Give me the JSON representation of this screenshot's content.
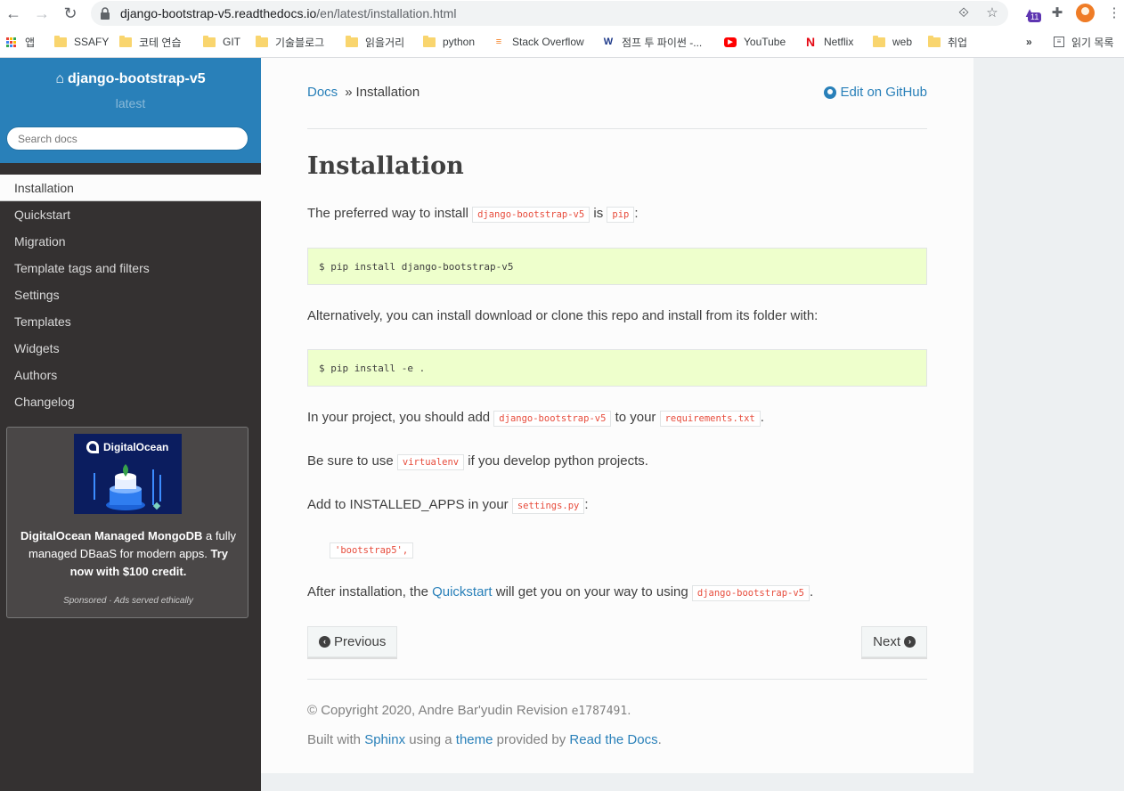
{
  "browser": {
    "url_host": "django-bootstrap-v5.readthedocs.io",
    "url_path": "/en/latest/installation.html",
    "extension_badge": "11",
    "bookmarks": [
      {
        "label": "앱",
        "icon": "apps-grid-icon"
      },
      {
        "label": "SSAFY",
        "icon": "folder-icon"
      },
      {
        "label": "코테 연습",
        "icon": "folder-icon"
      },
      {
        "label": "GIT",
        "icon": "folder-icon"
      },
      {
        "label": "기술블로그",
        "icon": "folder-icon"
      },
      {
        "label": "읽을거리",
        "icon": "folder-icon"
      },
      {
        "label": "python",
        "icon": "folder-icon"
      },
      {
        "label": "Stack Overflow",
        "icon": "stackoverflow-icon"
      },
      {
        "label": "점프 투 파이썬 -...",
        "icon": "wikidocs-icon"
      },
      {
        "label": "YouTube",
        "icon": "youtube-icon"
      },
      {
        "label": "Netflix",
        "icon": "netflix-icon"
      },
      {
        "label": "web",
        "icon": "folder-icon"
      },
      {
        "label": "취업",
        "icon": "folder-icon"
      }
    ],
    "more_bookmarks": "»",
    "reading_list": "읽기 목록"
  },
  "sidebar": {
    "project": "django-bootstrap-v5",
    "version": "latest",
    "search_placeholder": "Search docs",
    "items": [
      {
        "label": "Installation"
      },
      {
        "label": "Quickstart"
      },
      {
        "label": "Migration"
      },
      {
        "label": "Template tags and filters"
      },
      {
        "label": "Settings"
      },
      {
        "label": "Templates"
      },
      {
        "label": "Widgets"
      },
      {
        "label": "Authors"
      },
      {
        "label": "Changelog"
      }
    ],
    "ad": {
      "brand": "DigitalOcean",
      "headline": "DigitalOcean Managed MongoDB",
      "body": " a fully managed DBaaS for modern apps. ",
      "cta": "Try now with $100 credit.",
      "sponsor": "Sponsored · Ads served ethically"
    }
  },
  "content": {
    "breadcrumb_root": "Docs",
    "breadcrumb_sep": "»",
    "breadcrumb_current": "Installation",
    "edit_link": "Edit on GitHub",
    "title": "Installation",
    "p1_a": "The preferred way to install ",
    "p1_code1": "django-bootstrap-v5",
    "p1_b": " is ",
    "p1_code2": "pip",
    "p1_c": ":",
    "code1": "$ pip install django-bootstrap-v5",
    "p2": "Alternatively, you can install download or clone this repo and install from its folder with:",
    "code2": "$ pip install -e .",
    "p3_a": "In your project, you should add ",
    "p3_code1": "django-bootstrap-v5",
    "p3_b": " to your ",
    "p3_code2": "requirements.txt",
    "p3_c": ".",
    "p4_a": "Be sure to use ",
    "p4_code": "virtualenv",
    "p4_b": " if you develop python projects.",
    "p5_a": "Add to INSTALLED_APPS in your ",
    "p5_code": "settings.py",
    "p5_b": ":",
    "snippet": "'bootstrap5',",
    "p6_a": "After installation, the ",
    "p6_link": "Quickstart",
    "p6_b": " will get you on your way to using ",
    "p6_code": "django-bootstrap-v5",
    "p6_c": ".",
    "prev": "Previous",
    "next": "Next",
    "copyright": "© Copyright 2020, Andre Bar'yudin Revision ",
    "revision": "e1787491",
    "copyright_end": ".",
    "built_a": "Built with ",
    "sphinx": "Sphinx",
    "built_b": " using a ",
    "theme": "theme",
    "built_c": " provided by ",
    "rtd": "Read the Docs",
    "built_d": "."
  },
  "colors": {
    "accent": "#2980b9",
    "sidebar_bg": "#343131",
    "code_bg": "#eeffcc",
    "literal": "#e74c3c"
  }
}
